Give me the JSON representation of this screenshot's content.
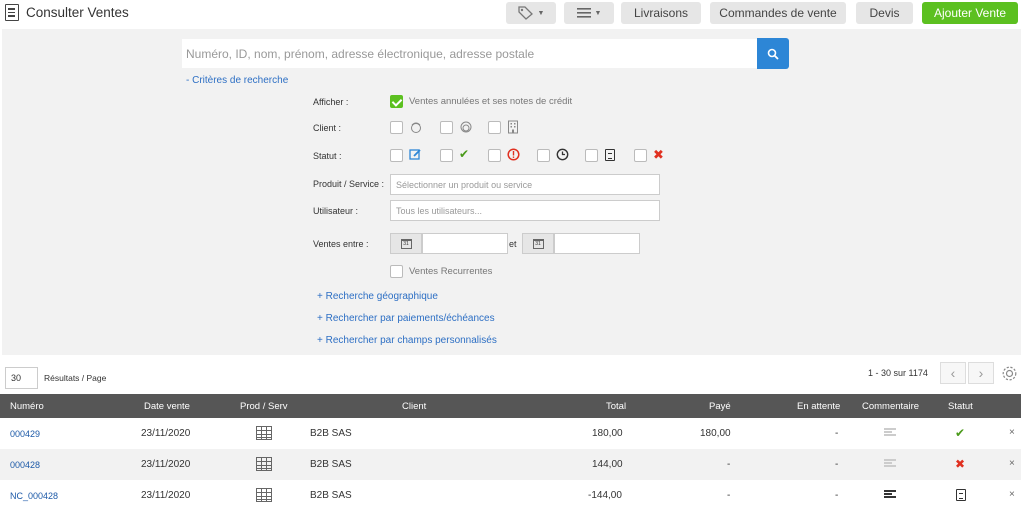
{
  "header": {
    "title": "Consulter Ventes",
    "buttons": {
      "livraisons": "Livraisons",
      "commandes": "Commandes de vente",
      "devis": "Devis",
      "ajouter": "Ajouter Vente"
    },
    "icons": [
      "tag-icon",
      "menu-icon"
    ]
  },
  "search": {
    "placeholder": "Numéro, ID, nom, prénom, adresse électronique, adresse postale",
    "criteria_link": "- Critères de recherche"
  },
  "filters": {
    "afficher_label": "Afficher :",
    "afficher_option": "Ventes annulées et ses notes de crédit",
    "afficher_checked": true,
    "client_label": "Client :",
    "statut_label": "Statut :",
    "produit_label": "Produit / Service :",
    "produit_placeholder": "Sélectionner un produit ou service",
    "utilisateur_label": "Utilisateur :",
    "utilisateur_placeholder": "Tous les utilisateurs...",
    "ventes_entre_label": "Ventes entre :",
    "et_label": "et",
    "calendar_day": "31",
    "recurrentes_label": "Ventes Recurrentes",
    "links": {
      "geo": "+ Recherche géographique",
      "paiements": "+ Rechercher par paiements/échéances",
      "champs": "+ Rechercher par champs personnalisés"
    }
  },
  "pagination": {
    "per_page": "30",
    "per_page_label": "Résultats / Page",
    "range": "1 - 30 sur 1174"
  },
  "table": {
    "headers": {
      "numero": "Numéro",
      "date": "Date vente",
      "prod": "Prod / Serv",
      "client": "Client",
      "total": "Total",
      "paye": "Payé",
      "attente": "En attente",
      "commentaire": "Commentaire",
      "statut": "Statut"
    },
    "rows": [
      {
        "numero": "000429",
        "date": "23/11/2020",
        "client": "B2B SAS",
        "total": "180,00",
        "paye": "180,00",
        "attente": "-",
        "status": "paid",
        "status_symbol": "✔",
        "comment": false
      },
      {
        "numero": "000428",
        "date": "23/11/2020",
        "client": "B2B SAS",
        "total": "144,00",
        "paye": "-",
        "attente": "-",
        "status": "cancelled",
        "status_symbol": "✖",
        "comment": false
      },
      {
        "numero": "NC_000428",
        "date": "23/11/2020",
        "client": "B2B SAS",
        "total": "-144,00",
        "paye": "-",
        "attente": "-",
        "status": "credit-note",
        "status_symbol": "",
        "comment": true
      }
    ],
    "delete_symbol": "×"
  },
  "colors": {
    "accent_green": "#5cc020",
    "search_blue": "#2d86d6",
    "link_blue": "#2d6fc4",
    "header_grey": "#565656",
    "error_red": "#e03020"
  }
}
